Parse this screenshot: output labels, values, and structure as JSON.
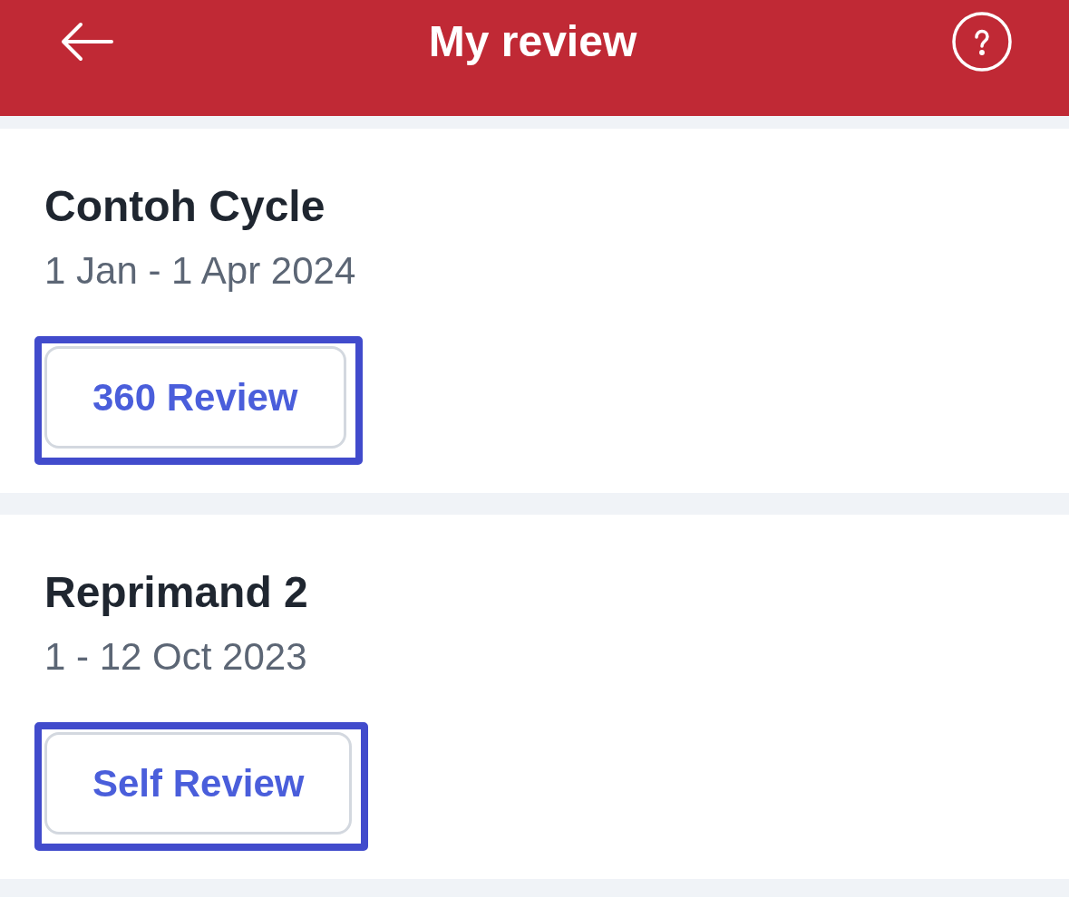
{
  "header": {
    "title": "My review"
  },
  "cards": [
    {
      "title": "Contoh Cycle",
      "dates": "1 Jan - 1 Apr 2024",
      "button": {
        "label": "360 Review",
        "highlighted": true
      }
    },
    {
      "title": "Reprimand 2",
      "dates": "1 - 12 Oct 2023",
      "button": {
        "label": "Self Review",
        "highlighted": true
      }
    }
  ]
}
